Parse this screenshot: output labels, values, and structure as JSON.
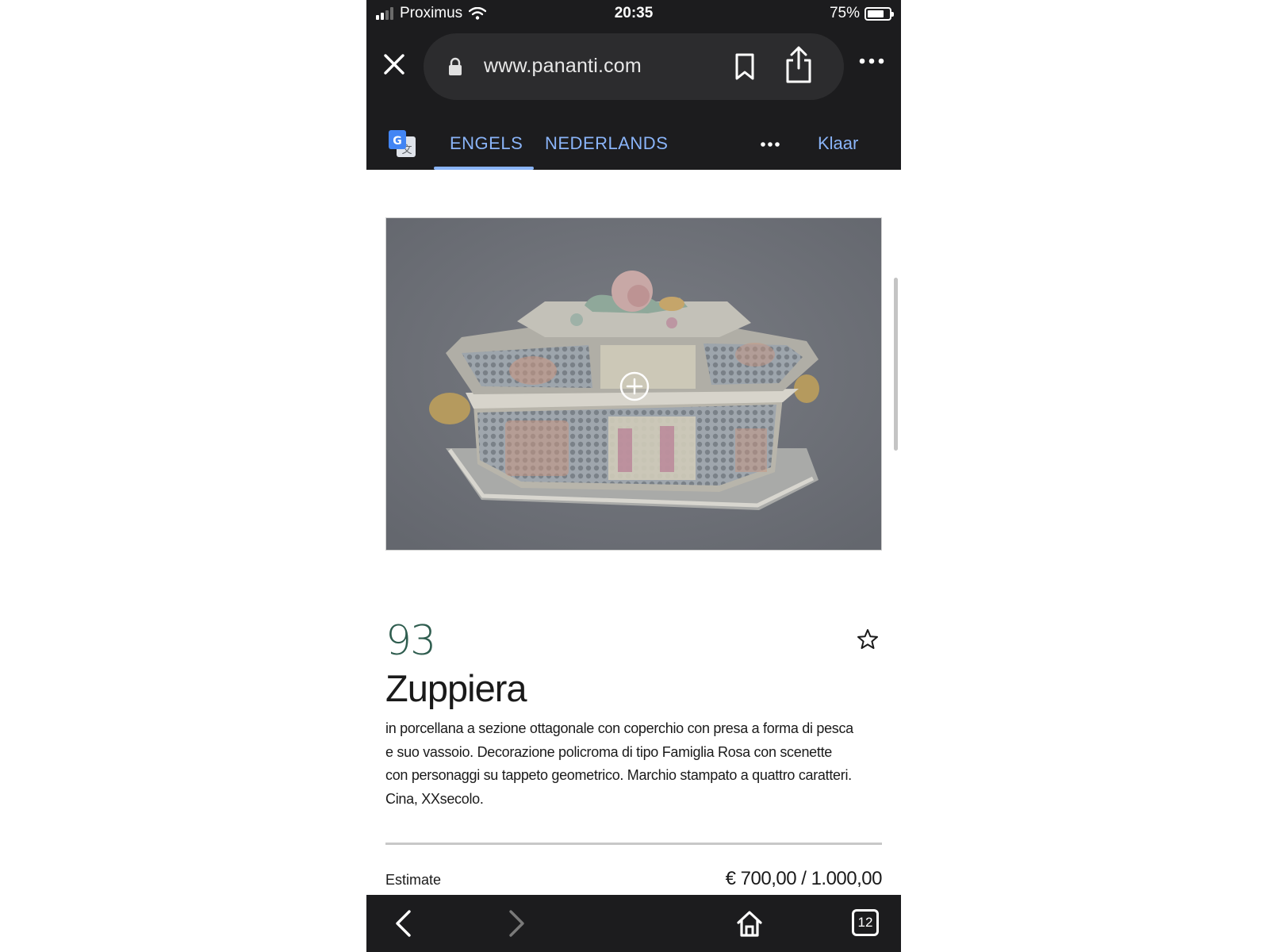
{
  "status_bar": {
    "carrier": "Proximus",
    "time": "20:35",
    "battery": "75%",
    "battery_level": 0.75
  },
  "browser": {
    "url": "www.pananti.com"
  },
  "translate_bar": {
    "tabs": [
      {
        "label": "ENGELS",
        "active": true
      },
      {
        "label": "NEDERLANDS",
        "active": false
      }
    ],
    "done_label": "Klaar"
  },
  "lot": {
    "number": "93",
    "title": "Zuppiera",
    "description": "in porcellana a sezione ottagonale con coperchio con presa a forma di pesca e suo vassoio. Decorazione policroma di tipo Famiglia Rosa con scenette con personaggi su tappeto geometrico. Marchio stampato a quattro caratteri. Cina, XXsecolo.",
    "estimate_label": "Estimate",
    "estimate_value": "€ 700,00 / 1.000,00"
  },
  "bottom_bar": {
    "tab_count": "12"
  },
  "colors": {
    "browser_chrome": "#1c1c1e",
    "url_pill": "#2c2c2e",
    "translate_accent": "#8ab4f8",
    "lot_number": "#2f5d4f",
    "image_background": "#6f7279"
  },
  "icons": [
    "signal-icon",
    "wifi-icon",
    "battery-icon",
    "close-icon",
    "lock-icon",
    "bookmark-icon",
    "share-icon",
    "more-icon",
    "google-translate-icon",
    "zoom-plus-icon",
    "star-icon",
    "back-arrow-icon",
    "forward-arrow-icon",
    "home-icon",
    "tabs-icon"
  ]
}
